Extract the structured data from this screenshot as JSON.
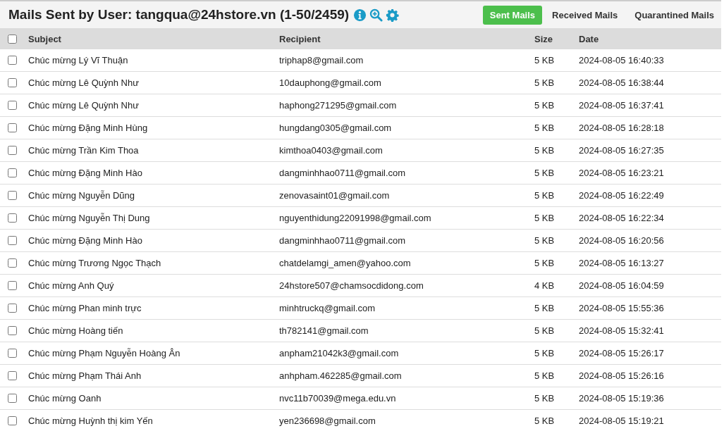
{
  "title": "Mails Sent by User: tangqua@24hstore.vn (1-50/2459)",
  "tabs": [
    {
      "label": "Sent Mails",
      "selected": true
    },
    {
      "label": "Received Mails",
      "selected": false
    },
    {
      "label": "Quarantined Mails",
      "selected": false
    }
  ],
  "table": {
    "select_all_checked": false,
    "columns": [
      "Subject",
      "Recipient",
      "Size",
      "Date"
    ],
    "rows": [
      {
        "checked": false,
        "cells": [
          "Chúc mừng Lý Vĩ Thuận",
          "triphap8@gmail.com",
          "5 KB",
          "2024-08-05 16:40:33"
        ]
      },
      {
        "checked": false,
        "cells": [
          "Chúc mừng Lê Quỳnh Như",
          "10dauphong@gmail.com",
          "5 KB",
          "2024-08-05 16:38:44"
        ]
      },
      {
        "checked": false,
        "cells": [
          "Chúc mừng Lê Quỳnh Như",
          "haphong271295@gmail.com",
          "5 KB",
          "2024-08-05 16:37:41"
        ]
      },
      {
        "checked": false,
        "cells": [
          "Chúc mừng Đặng Minh Hùng",
          "hungdang0305@gmail.com",
          "5 KB",
          "2024-08-05 16:28:18"
        ]
      },
      {
        "checked": false,
        "cells": [
          "Chúc mừng Trần Kim Thoa",
          "kimthoa0403@gmail.com",
          "5 KB",
          "2024-08-05 16:27:35"
        ]
      },
      {
        "checked": false,
        "cells": [
          "Chúc mừng Đặng Minh Hào",
          "dangminhhao0711@gmail.com",
          "5 KB",
          "2024-08-05 16:23:21"
        ]
      },
      {
        "checked": false,
        "cells": [
          "Chúc mừng Nguyễn Dũng",
          "zenovasaint01@gmail.com",
          "5 KB",
          "2024-08-05 16:22:49"
        ]
      },
      {
        "checked": false,
        "cells": [
          "Chúc mừng Nguyễn Thị Dung",
          "nguyenthidung22091998@gmail.com",
          "5 KB",
          "2024-08-05 16:22:34"
        ]
      },
      {
        "checked": false,
        "cells": [
          "Chúc mừng Đặng Minh Hào",
          "dangminhhao0711@gmail.com",
          "5 KB",
          "2024-08-05 16:20:56"
        ]
      },
      {
        "checked": false,
        "cells": [
          "Chúc mừng Trương Ngọc Thạch",
          "chatdelamgi_amen@yahoo.com",
          "5 KB",
          "2024-08-05 16:13:27"
        ]
      },
      {
        "checked": false,
        "cells": [
          "Chúc mừng Anh Quý",
          "24hstore507@chamsocdidong.com",
          "4 KB",
          "2024-08-05 16:04:59"
        ]
      },
      {
        "checked": false,
        "cells": [
          "Chúc mừng Phan minh trực",
          "minhtruckq@gmail.com",
          "5 KB",
          "2024-08-05 15:55:36"
        ]
      },
      {
        "checked": false,
        "cells": [
          "Chúc mừng Hoàng tiến",
          "th782141@gmail.com",
          "5 KB",
          "2024-08-05 15:32:41"
        ]
      },
      {
        "checked": false,
        "cells": [
          "Chúc mừng Phạm Nguyễn Hoàng Ân",
          "anpham21042k3@gmail.com",
          "5 KB",
          "2024-08-05 15:26:17"
        ]
      },
      {
        "checked": false,
        "cells": [
          "Chúc mừng Phạm Thái Anh",
          "anhpham.462285@gmail.com",
          "5 KB",
          "2024-08-05 15:26:16"
        ]
      },
      {
        "checked": false,
        "cells": [
          "Chúc mừng Oanh",
          "nvc11b70039@mega.edu.vn",
          "5 KB",
          "2024-08-05 15:19:36"
        ]
      },
      {
        "checked": false,
        "cells": [
          "Chúc mừng Huỳnh thị kim Yến",
          "yen236698@gmail.com",
          "5 KB",
          "2024-08-05 15:19:21"
        ]
      }
    ]
  }
}
